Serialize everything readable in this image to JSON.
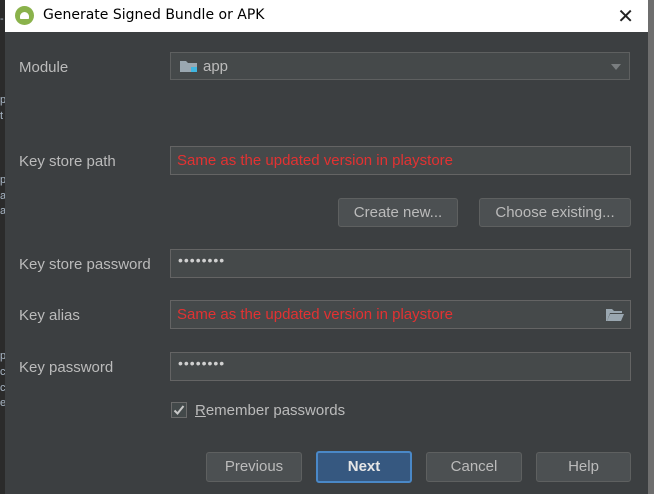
{
  "window": {
    "title": "Generate Signed Bundle or APK",
    "close_glyph": "✕",
    "app_icon": "android-icon"
  },
  "module": {
    "label": "Module",
    "value": "app",
    "icon": "folder-icon"
  },
  "keystore": {
    "path_label": "Key store path",
    "path_value": "Same as the updated version in playstore",
    "create_new": "Create new...",
    "choose_existing": "Choose existing...",
    "password_label": "Key store password",
    "password_value": "••••••••"
  },
  "key": {
    "alias_label": "Key alias",
    "alias_value": "Same as the updated version in playstore",
    "password_label": "Key password",
    "password_value": "••••••••"
  },
  "remember": {
    "mnemonic": "R",
    "rest": "emember passwords",
    "checked": true
  },
  "footer": {
    "previous": "Previous",
    "next": "Next",
    "cancel": "Cancel",
    "help": "Help"
  },
  "colors": {
    "dialog_bg": "#3c3f41",
    "field_bg": "#45494a",
    "annotation_red": "#e23232",
    "primary_button": "#365880"
  }
}
